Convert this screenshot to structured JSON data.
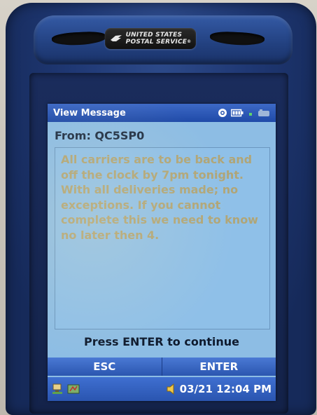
{
  "device": {
    "brand_line1": "UNITED STATES",
    "brand_line2": "POSTAL SERVICE",
    "brand_mark": "®"
  },
  "titlebar": {
    "title": "View Message",
    "icons": [
      "gps-icon",
      "battery-icon",
      "signal-icon",
      "radio-icon"
    ]
  },
  "message": {
    "from_label": "From: QC5SP0",
    "body": "All carriers are to be back and off the clock by 7pm tonight. With all deliveries made; no exceptions. If you cannot complete this we need to know no later then 4."
  },
  "prompt": "Press ENTER to continue",
  "softkeys": {
    "left": "ESC",
    "right": "ENTER"
  },
  "taskbar": {
    "datetime": "03/21 12:04 PM"
  },
  "colors": {
    "screen_bg": "#8dbde4",
    "titlebar": "#2a55b0",
    "message_text": "#b0a577",
    "device_blue": "#1f3874"
  }
}
